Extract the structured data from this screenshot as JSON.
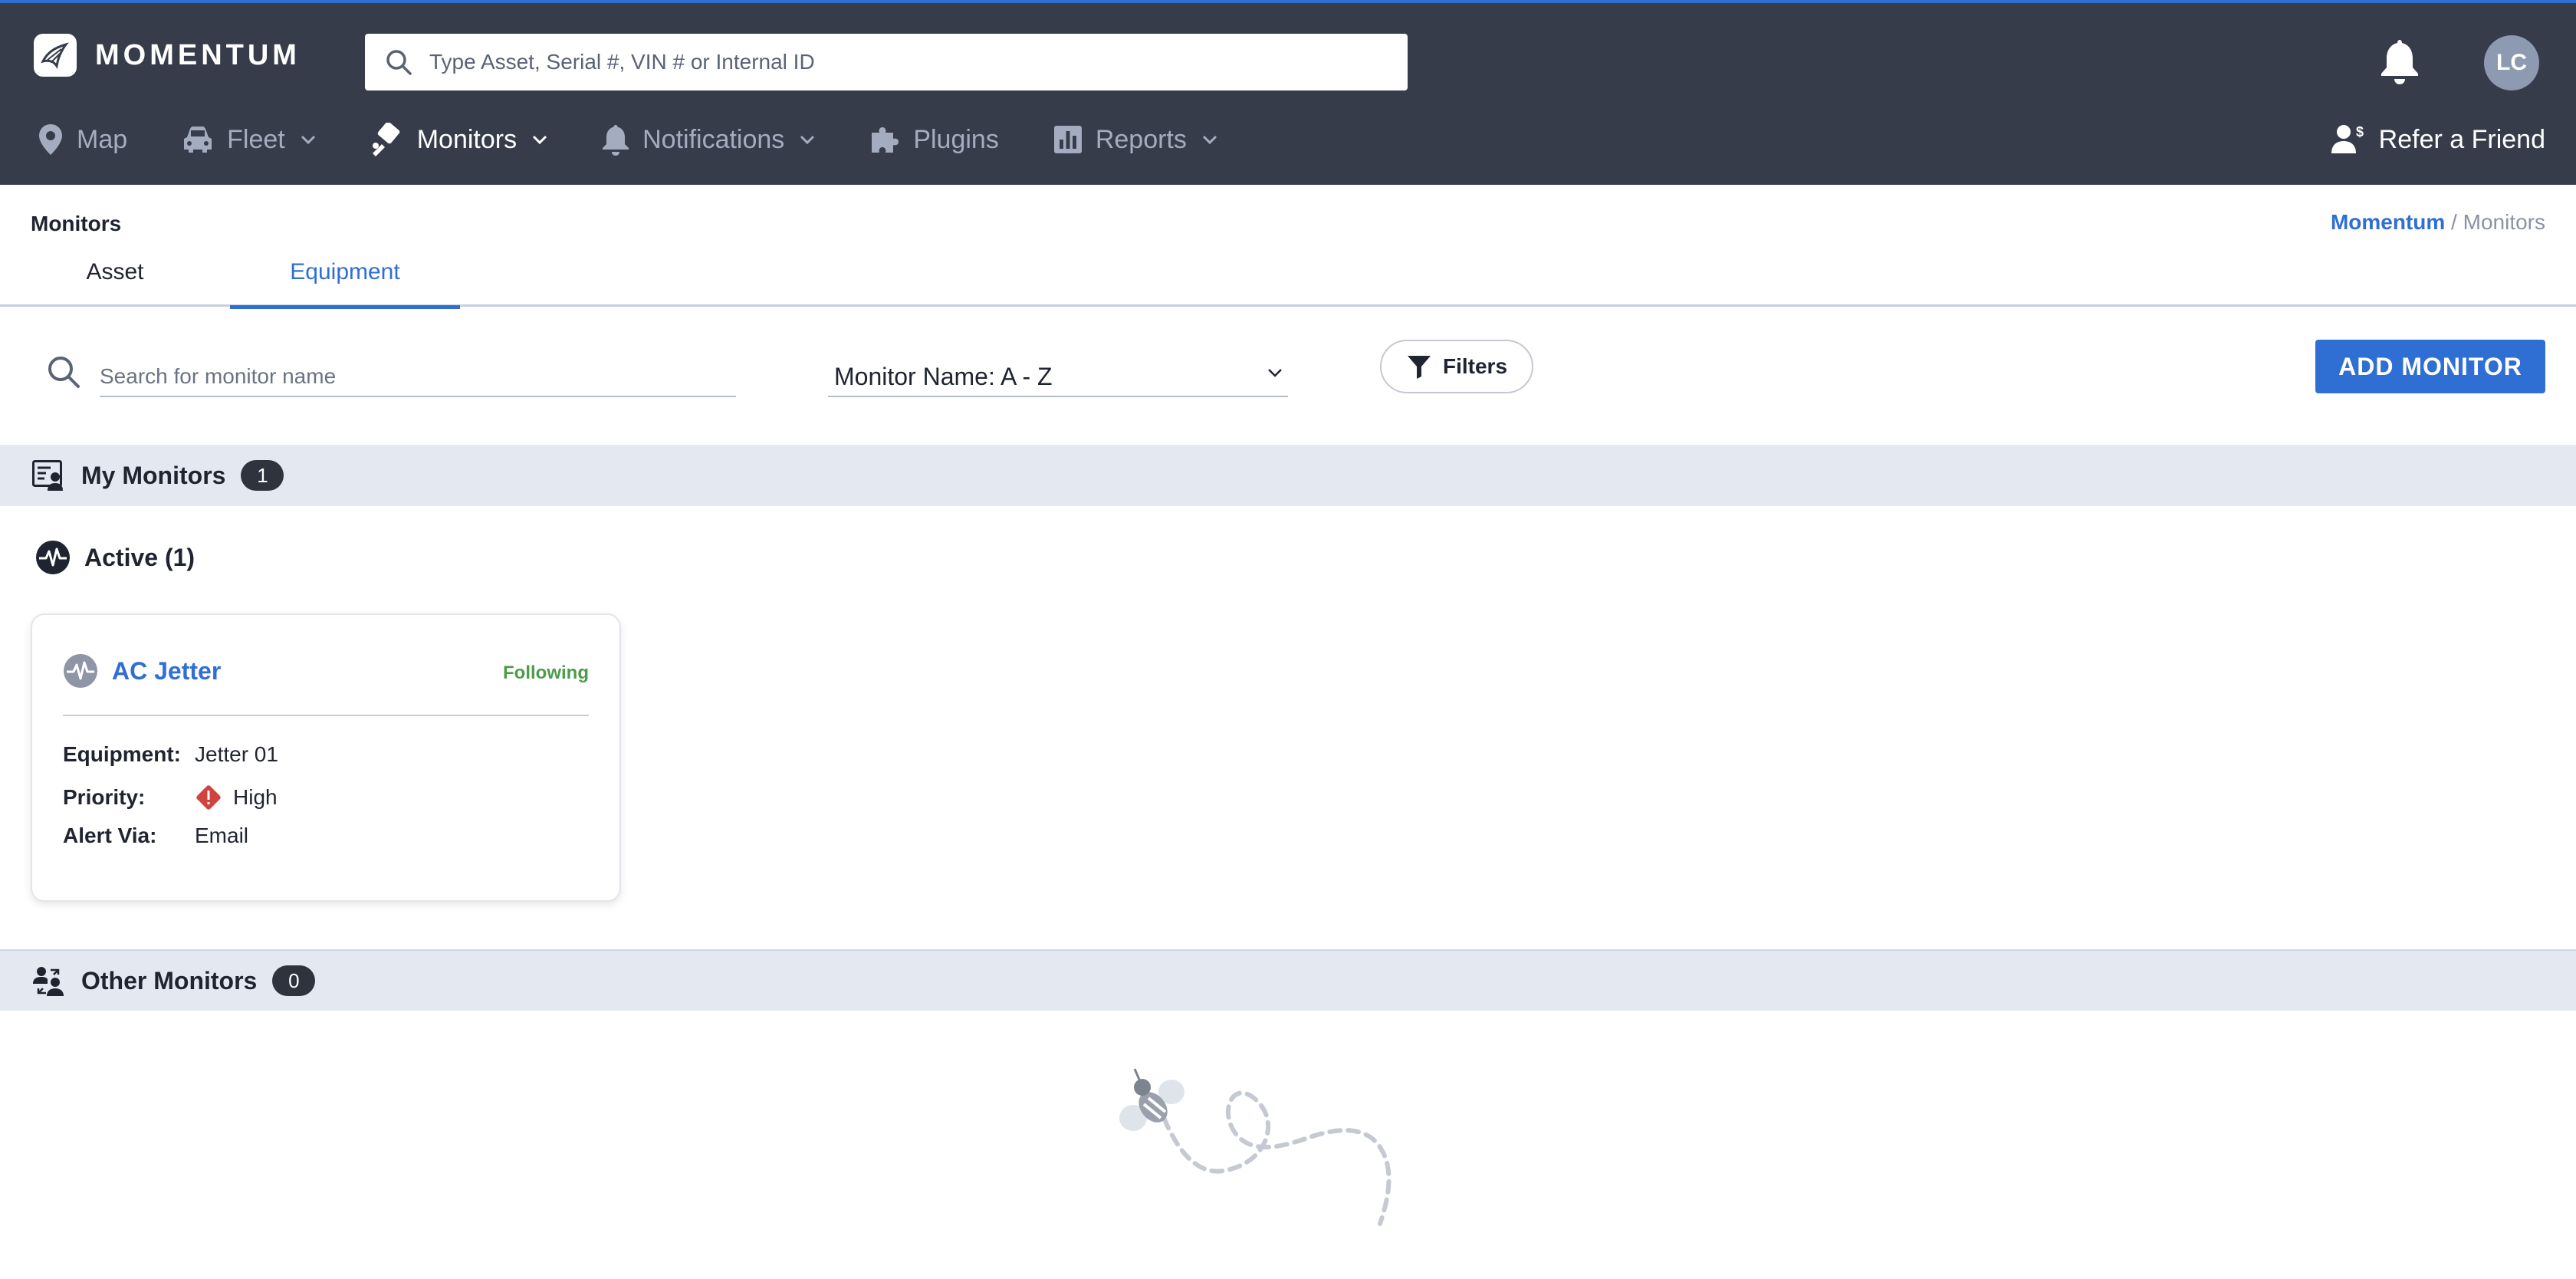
{
  "header": {
    "logo_text": "MOMENTUM",
    "search_placeholder": "Type Asset, Serial #, VIN # or Internal ID",
    "avatar_initials": "LC",
    "nav": [
      {
        "label": "Map",
        "icon": "map-pin-icon",
        "dropdown": false
      },
      {
        "label": "Fleet",
        "icon": "car-icon",
        "dropdown": true
      },
      {
        "label": "Monitors",
        "icon": "monitors-icon",
        "dropdown": true,
        "active": true
      },
      {
        "label": "Notifications",
        "icon": "bell-icon",
        "dropdown": true
      },
      {
        "label": "Plugins",
        "icon": "puzzle-icon",
        "dropdown": false
      },
      {
        "label": "Reports",
        "icon": "bar-chart-icon",
        "dropdown": true
      }
    ],
    "refer_label": "Refer a Friend"
  },
  "page": {
    "title": "Monitors",
    "breadcrumb": {
      "root": "Momentum",
      "separator": " / ",
      "current": "Monitors"
    },
    "tabs": [
      {
        "label": "Asset",
        "active": false
      },
      {
        "label": "Equipment",
        "active": true
      }
    ]
  },
  "toolbar": {
    "search_placeholder": "Search for monitor name",
    "sort_value": "Monitor Name: A - Z",
    "filters_label": "Filters",
    "add_label": "ADD MONITOR"
  },
  "my_monitors": {
    "title": "My Monitors",
    "count": "1",
    "active_group_label": "Active (1)",
    "cards": [
      {
        "name": "AC Jetter",
        "status": "Following",
        "fields": [
          {
            "label": "Equipment:",
            "value": "Jetter 01"
          },
          {
            "label": "Priority:",
            "value": "High",
            "icon": "priority-high-icon"
          },
          {
            "label": "Alert Via:",
            "value": "Email"
          }
        ]
      }
    ]
  },
  "other_monitors": {
    "title": "Other Monitors",
    "count": "0"
  },
  "colors": {
    "header_bg": "#373c4a",
    "accent": "#2f6fd3",
    "section_bg": "#e4e8f1",
    "following_green": "#4e9b4b",
    "priority_high_red": "#d0433f"
  }
}
